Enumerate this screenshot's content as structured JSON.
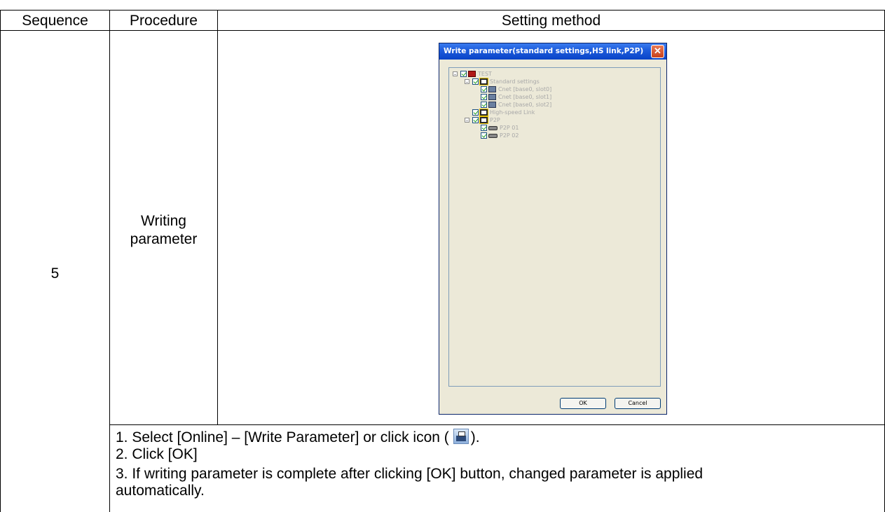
{
  "table": {
    "headers": {
      "sequence": "Sequence",
      "procedure": "Procedure",
      "setting_method": "Setting method"
    },
    "sequence_value": "5",
    "procedure_line1": "Writing",
    "procedure_line2": "parameter"
  },
  "dialog": {
    "title": "Write parameter(standard settings,HS link,P2P)",
    "close_glyph": "✕",
    "tree": {
      "root": "TEST",
      "standard_settings": "Standard settings",
      "cnet0": "Cnet [base0, slot0]",
      "cnet1": "Cnet [base0, slot1]",
      "cnet2": "Cnet [base0, slot2]",
      "high_speed_link": "High-speed Link",
      "p2p": "P2P",
      "p2p01": "P2P 01",
      "p2p02": "P2P 02"
    },
    "ok_label": "OK",
    "cancel_label": "Cancel"
  },
  "instructions": {
    "line1_before": "1. Select [Online] – [Write Parameter] or click icon (",
    "line1_after": ").",
    "line2": "2. Click [OK]",
    "line3": "3. If writing parameter is complete after clicking [OK] button, changed parameter is applied",
    "line4": "automatically."
  },
  "icons": {
    "write_parameter_icon": "write-parameter-icon",
    "expand_icon": "minus-box-icon",
    "checkbox_icon": "checked-checkbox-icon"
  }
}
